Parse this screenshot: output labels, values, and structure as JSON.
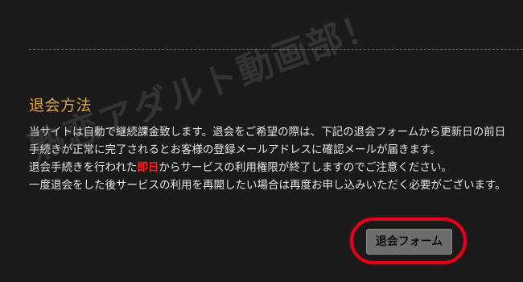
{
  "withdrawal": {
    "title": "退会方法",
    "line1": "当サイトは自動で継続課金致します。退会をご希望の際は、下記の退会フォームから更新日の前日",
    "line2": "手続きが正常に完了されるとお客様の登録メールアドレスに確認メールが届きます。",
    "line3_before": "退会手続きを行われた",
    "line3_emphasis": "即日",
    "line3_after": "からサービスの利用権限が終了しますのでご注意ください。",
    "line4": "一度退会をした後サービスの利用を再開したい場合は再度お申し込みいただく必要がございます。",
    "form_button_label": "退会フォーム"
  },
  "watermark": {
    "text": "熟恋アダルト動画部！"
  },
  "colors": {
    "background": "#1a1a1a",
    "title": "#e0a23a",
    "body_text": "#e6e6e6",
    "emphasis": "#ff1c1c",
    "highlight_ring": "#e3001b",
    "button_bg": "#6d6d6d"
  }
}
